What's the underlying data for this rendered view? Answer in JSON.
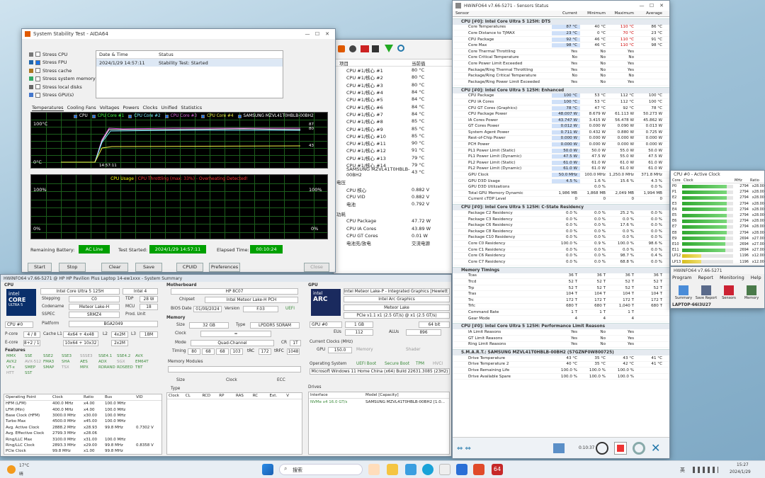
{
  "stability": {
    "title": "System Stability Test - AIDA64",
    "stress_items": [
      "Stress CPU",
      "Stress FPU",
      "Stress cache",
      "Stress system memory",
      "Stress local disks",
      "Stress GPU(s)"
    ],
    "log_headers": [
      "Date & Time",
      "Status"
    ],
    "log_row": [
      "2024/1/29 14:57:11",
      "Stability Test: Started"
    ],
    "tabs": [
      "Temperatures",
      "Cooling Fans",
      "Voltages",
      "Powers",
      "Clocks",
      "Unified",
      "Statistics"
    ],
    "legend": [
      "CPU",
      "CPU Core #1",
      "CPU Core #2",
      "CPU Core #3",
      "CPU Core #4",
      "SAMSUNG MZVL41T0HBLB-00BH2"
    ],
    "temp_top": "100°C",
    "temp_bot": "0°C",
    "temp_time": "14:57:11",
    "temp_r1": "87",
    "temp_r2": "80",
    "temp_r3": "43",
    "usage_title": "CPU Usage",
    "usage_throttle": "CPU Throttling (max: 33%) - Overheating Detected!",
    "usage_top_l": "100%",
    "usage_bot_l": "0%",
    "usage_top_r": "100%",
    "usage_bot_r": "0%",
    "battery_label": "Remaining Battery:",
    "battery_val": "AC Line",
    "started_label": "Test Started:",
    "started_val": "2024/1/29 14:57:11",
    "elapsed_label": "Elapsed Time:",
    "elapsed_val": "00:10:24",
    "buttons": [
      "Start",
      "Stop",
      "Clear",
      "Save",
      "CPUID",
      "Preferences",
      "Close"
    ]
  },
  "coretemps": {
    "col1": "项目",
    "col2": "当前值",
    "rows": [
      [
        "CPU #1/核心 #1",
        "80 °C"
      ],
      [
        "CPU #1/核心 #2",
        "80 °C"
      ],
      [
        "CPU #1/核心 #3",
        "80 °C"
      ],
      [
        "CPU #1/核心 #4",
        "84 °C"
      ],
      [
        "CPU #1/核心 #5",
        "84 °C"
      ],
      [
        "CPU #1/核心 #6",
        "84 °C"
      ],
      [
        "CPU #1/核心 #7",
        "84 °C"
      ],
      [
        "CPU #1/核心 #8",
        "85 °C"
      ],
      [
        "CPU #1/核心 #9",
        "85 °C"
      ],
      [
        "CPU #1/核心 #10",
        "85 °C"
      ],
      [
        "CPU #1/核心 #11",
        "90 °C"
      ],
      [
        "CPU #1/核心 #12",
        "91 °C"
      ],
      [
        "CPU #1/核心 #13",
        "79 °C"
      ],
      [
        "CPU #1/核心 #14",
        "79 °C"
      ],
      [
        "SAMSUNG MZVL41T0HBLB-00BH2",
        "43 °C"
      ]
    ],
    "volt_head": "电压",
    "volt": [
      [
        "CPU 核心",
        "0.882 V"
      ],
      [
        "CPU VID",
        "0.882 V"
      ],
      [
        "电池",
        "0.792 V"
      ]
    ],
    "power_head": "功耗",
    "power": [
      [
        "CPU Package",
        "47.72 W"
      ],
      [
        "CPU IA Cores",
        "43.89 W"
      ],
      [
        "CPU GT Cores",
        "0.01 W"
      ],
      [
        "电池充/放电",
        "交流电源"
      ]
    ]
  },
  "hwinfo": {
    "title": "HWiNFO64 v7.66-5271 - Sensors Status",
    "cols": [
      "Sensor",
      "Current",
      "Minimum",
      "Maximum",
      "Average"
    ],
    "g1": "CPU [#0]: Intel Core Ultra 5 125H: DTS",
    "g1rows": [
      [
        "Core Temperatures",
        "87 °C",
        "40 °C",
        "110 °C",
        "86 °C"
      ],
      [
        "Core Distance to TjMAX",
        "23 °C",
        "0 °C",
        "70 °C",
        "23 °C"
      ],
      [
        "CPU Package",
        "92 °C",
        "46 °C",
        "110 °C",
        "91 °C"
      ],
      [
        "Core Max",
        "98 °C",
        "46 °C",
        "110 °C",
        "98 °C"
      ],
      [
        "Core Thermal Throttling",
        "Yes",
        "No",
        "Yes",
        ""
      ],
      [
        "Core Critical Temperature",
        "No",
        "No",
        "No",
        ""
      ],
      [
        "Core Power Limit Exceeded",
        "Yes",
        "No",
        "Yes",
        ""
      ],
      [
        "Package/Ring Thermal Throttling",
        "Yes",
        "No",
        "Yes",
        ""
      ],
      [
        "Package/Ring Critical Temperature",
        "No",
        "No",
        "No",
        ""
      ],
      [
        "Package/Ring Power Limit Exceeded",
        "Yes",
        "No",
        "Yes",
        ""
      ]
    ],
    "g2": "CPU [#0]: Intel Core Ultra 5 125H: Enhanced",
    "g2rows": [
      [
        "CPU Package",
        "100 °C",
        "53 °C",
        "112 °C",
        "100 °C"
      ],
      [
        "CPU IA Cores",
        "100 °C",
        "53 °C",
        "112 °C",
        "100 °C"
      ],
      [
        "CPU GT Cores (Graphics)",
        "78 °C",
        "47 °C",
        "92 °C",
        "78 °C"
      ],
      [
        "CPU Package Power",
        "48.007 W",
        "8.679 W",
        "61.113 W",
        "50.273 W"
      ],
      [
        "IA Cores Power",
        "43.747 W",
        "3.415 W",
        "56.478 W",
        "45.862 W"
      ],
      [
        "GT Cores Power",
        "0.012 W",
        "0.000 W",
        "0.090 W",
        "0.013 W"
      ],
      [
        "System Agent Power",
        "0.711 W",
        "0.432 W",
        "0.880 W",
        "0.725 W"
      ],
      [
        "Rest-of-Chip Power",
        "0.000 W",
        "0.000 W",
        "0.000 W",
        "0.000 W"
      ],
      [
        "PCH Power",
        "0.000 W",
        "0.000 W",
        "0.000 W",
        "0.000 W"
      ],
      [
        "PL1 Power Limit (Static)",
        "50.0 W",
        "50.0 W",
        "55.0 W",
        "50.0 W"
      ],
      [
        "PL1 Power Limit (Dynamic)",
        "47.5 W",
        "47.5 W",
        "55.0 W",
        "47.5 W"
      ],
      [
        "PL2 Power Limit (Static)",
        "61.0 W",
        "61.0 W",
        "61.0 W",
        "61.0 W"
      ],
      [
        "PL2 Power Limit (Dynamic)",
        "61.0 W",
        "61.0 W",
        "61.0 W",
        "61.0 W"
      ],
      [
        "GPU Clock",
        "50.0 MHz",
        "100.0 MHz",
        "1,250.0 MHz",
        "371.8 MHz"
      ],
      [
        "GPU D3D Usage",
        "4.5 %",
        "1.6 %",
        "15.6 %",
        "4.3 %"
      ],
      [
        "GPU D3D Utilizations",
        "",
        "0.0 %",
        "",
        "0.0 %"
      ],
      [
        "Total GPU Memory Dynamic",
        "1,986 MB",
        "1,868 MB",
        "2,049 MB",
        "1,994 MB"
      ],
      [
        "Current cTDP Level",
        "0",
        "0",
        "0",
        "0"
      ]
    ],
    "g3": "CPU [#0]: Intel Core Ultra 5 125H: C-State Residency",
    "g3rows": [
      [
        "Package C2 Residency",
        "0.0 %",
        "0.0 %",
        "25.2 %",
        "0.0 %"
      ],
      [
        "Package C3 Residency",
        "0.0 %",
        "0.0 %",
        "0.0 %",
        "0.0 %"
      ],
      [
        "Package C6 Residency",
        "0.0 %",
        "0.0 %",
        "17.6 %",
        "0.0 %"
      ],
      [
        "Package C8 Residency",
        "0.0 %",
        "0.0 %",
        "0.0 %",
        "0.0 %"
      ],
      [
        "Package C10 Residency",
        "0.0 %",
        "0.0 %",
        "0.0 %",
        "0.0 %"
      ],
      [
        "Core C0 Residency",
        "100.0 %",
        "0.9 %",
        "100.0 %",
        "98.6 %"
      ],
      [
        "Core C1 Residency",
        "0.0 %",
        "0.0 %",
        "0.0 %",
        "0.0 %"
      ],
      [
        "Core C6 Residency",
        "0.0 %",
        "0.0 %",
        "98.7 %",
        "0.4 %"
      ],
      [
        "Core C7 Residency",
        "0.0 %",
        "0.0 %",
        "68.8 %",
        "0.0 %"
      ]
    ],
    "g4": "Memory Timings",
    "g4rows": [
      [
        "Tcas",
        "36 T",
        "36 T",
        "36 T",
        "36 T"
      ],
      [
        "Trcd",
        "52 T",
        "52 T",
        "52 T",
        "52 T"
      ],
      [
        "Trp",
        "52 T",
        "52 T",
        "52 T",
        "52 T"
      ],
      [
        "Tras",
        "104 T",
        "104 T",
        "104 T",
        "104 T"
      ],
      [
        "Trc",
        "172 T",
        "172 T",
        "172 T",
        "172 T"
      ],
      [
        "Trfc",
        "680 T",
        "680 T",
        "1,040 T",
        "680 T"
      ],
      [
        "Command Rate",
        "1 T",
        "1 T",
        "1 T",
        ""
      ],
      [
        "Gear Mode",
        "4",
        "4",
        "4",
        ""
      ]
    ],
    "g5": "CPU [#0]: Intel Core Ultra 5 125H: Performance Limit Reasons",
    "g5rows": [
      [
        "IA Limit Reasons",
        "Yes",
        "No",
        "Yes",
        ""
      ],
      [
        "GT Limit Reasons",
        "Yes",
        "No",
        "Yes",
        ""
      ],
      [
        "Ring Limit Reasons",
        "Yes",
        "No",
        "Yes",
        ""
      ]
    ],
    "g6": "S.M.A.R.T.: SAMSUNG MZVL41T0HBLB-00BH2 (S7GZNF0W800725)",
    "g6rows": [
      [
        "Drive Temperature",
        "43 °C",
        "35 °C",
        "43 °C",
        "41 °C"
      ],
      [
        "Drive Temperature 2",
        "40 °C",
        "35 °C",
        "42 °C",
        "41 °C"
      ],
      [
        "Drive Remaining Life",
        "100.0 %",
        "100.0 %",
        "100.0 %",
        ""
      ],
      [
        "Drive Available Spare",
        "100.0 %",
        "100.0 %",
        "100.0 %",
        ""
      ]
    ],
    "timer": "0:10:37"
  },
  "activeclock": {
    "title": "CPU #0 - Active Clock",
    "cols": [
      "Core",
      "Clock",
      "MHz",
      "Ratio"
    ],
    "rows": [
      [
        "P0",
        "2794",
        "x28.00"
      ],
      [
        "P1",
        "2794",
        "x28.00"
      ],
      [
        "E2",
        "2794",
        "x28.00"
      ],
      [
        "E3",
        "2794",
        "x28.00"
      ],
      [
        "E4",
        "2794",
        "x28.00"
      ],
      [
        "E5",
        "2794",
        "x28.00"
      ],
      [
        "E6",
        "2794",
        "x28.00"
      ],
      [
        "E7",
        "2794",
        "x28.00"
      ],
      [
        "E8",
        "2794",
        "x28.00"
      ],
      [
        "E9",
        "2694",
        "x27.00"
      ],
      [
        "E10",
        "2694",
        "x27.00"
      ],
      [
        "E11",
        "2694",
        "x27.00"
      ],
      [
        "LP12",
        "1196",
        "x12.00"
      ],
      [
        "LP13",
        "1196",
        "x12.00"
      ]
    ],
    "fill": [
      0.88,
      0.88,
      0.88,
      0.88,
      0.88,
      0.88,
      0.88,
      0.88,
      0.88,
      0.85,
      0.85,
      0.85,
      0.38,
      0.38
    ]
  },
  "hwmini": {
    "title": "HWiNFO64 v7.66-5271",
    "menu": [
      "Program",
      "Report",
      "Monitoring",
      "Help"
    ],
    "tools": [
      "Summary",
      "Save Report",
      "Sensors",
      "Memory"
    ],
    "host": "LAPTOP-66I3U27"
  },
  "summary": {
    "title": "HWiNFO64 v7.66-5271 @ HP HP Pavilion Plus Laptop 14-ew1xxx - System Summary",
    "cpu_head": "CPU",
    "cpu_name": "Intel Core Ultra 5 125H",
    "cpu_node": "Intel 4",
    "stepping_l": "Stepping",
    "stepping": "C0",
    "tdp_l": "TDP",
    "tdp": "28 W",
    "codename_l": "Codename",
    "codename": "Meteor Lake-H",
    "mcu_l": "MCU",
    "mcu": "18",
    "sspec_l": "SSPEC",
    "sspec": "SRMZ4",
    "prod_l": "Prod. Unit",
    "prod": "",
    "platform_l": "Platform",
    "platform": "BGA2049",
    "cpu_sel": "CPU #0",
    "pcore_l": "P-core",
    "pcore": "4 / 8",
    "cachel1_l": "Cache L1",
    "cachel1": "4x64 + 4x48",
    "l2_l": "L2",
    "l2": "4x2M",
    "l3_l": "L3",
    "l3": "18M",
    "ecore_l": "E-core",
    "ecore": "8+2 / 10",
    "cachee": "10x64 + 10x32",
    "l2e": "2x2M",
    "features_l": "Features",
    "features": [
      "MMX",
      "SSE",
      "SSE2",
      "SSE3",
      "SSSE3",
      "SSE4.1",
      "SSE4.2",
      "AVX",
      "AVX2",
      "AVX-512",
      "FMA3",
      "SHA",
      "AES",
      "ADX",
      "SGX",
      "EM64T",
      "VT-x",
      "SMEP",
      "SMAP",
      "TSX",
      "MPX",
      "RDRAND",
      "RDSEED",
      "TBT",
      "HTT",
      "SST"
    ],
    "op_head": [
      "Operating Point",
      "Clock",
      "Ratio",
      "Bus",
      "VID"
    ],
    "op_rows": [
      [
        "HFM (LFM)",
        "400.0 MHz",
        "x4.00",
        "100.0 MHz",
        ""
      ],
      [
        "LFM (Min)",
        "400.0 MHz",
        "x4.00",
        "100.0 MHz",
        ""
      ],
      [
        "Base Clock (HFM)",
        "3000.0 MHz",
        "x30.00",
        "100.0 MHz",
        ""
      ],
      [
        "Turbo Max",
        "4500.0 MHz",
        "x45.00",
        "100.0 MHz",
        ""
      ],
      [
        "Avg. Active Clock",
        "2888.2 MHz",
        "x28.93",
        "99.8 MHz",
        "0.7302 V"
      ],
      [
        "Avg. Effective Clock",
        "2799.3 MHz",
        "x28.06",
        "",
        ""
      ],
      [
        "Ring/LLC Max",
        "3100.0 MHz",
        "x31.00",
        "100.0 MHz",
        ""
      ],
      [
        "Ring/LLC Clock",
        "2893.3 MHz",
        "x29.00",
        "99.8 MHz",
        "0.8358 V"
      ],
      [
        "PCIe Clock",
        "99.8 MHz",
        "x1.00",
        "99.8 MHz",
        ""
      ]
    ],
    "mb_head": "Motherboard",
    "mb": "HP 8C07",
    "chipset_l": "Chipset",
    "chipset": "Intel Meteor Lake-H PCH",
    "bios_l": "BIOS Date",
    "bios": "01/09/2024",
    "ver_l": "Version",
    "ver": "F.03",
    "uefi": "UEFI",
    "mem_head": "Memory",
    "size_l": "Size",
    "size": "32 GB",
    "type_l": "Type",
    "type": "LPDDR5 SDRAM",
    "clock_l": "Clock",
    "clock": "=",
    "mode_l": "Mode",
    "mode": "Quad-Channel",
    "cr_l": "CR",
    "cr": "1T",
    "timing_l": "Timing",
    "timings": [
      "80",
      "68",
      "68",
      "103",
      "tRC",
      "172",
      "tRFC",
      "1048"
    ],
    "modules_l": "Memory Modules",
    "msize_l": "Size",
    "mclock_l": "Clock",
    "ecc_l": "ECC",
    "mtype_l": "Type",
    "mcols": [
      "Clock",
      "CL",
      "RCD",
      "RP",
      "RAS",
      "RC",
      "Ext.",
      "V"
    ],
    "gpu_head": "GPU",
    "gpu_name": "Intel Meteor Lake-P - Integrated Graphics [Hewlett Pac",
    "gpu_sub": "Intel Arc Graphics",
    "gpu_code": "Meteor Lake",
    "gpu_pcie": "PCIe v1.1 x1 (2.5 GT/s) @ x1 (2.5 GT/s)",
    "gpu_sel": "GPU #0",
    "gpu_mem": "1 GB",
    "gpu_bus": "64 bit",
    "eus_l": "EUs",
    "eus": "112",
    "alus_l": "ALUs",
    "alus": "896",
    "clocks_l": "Current Clocks (MHz)",
    "gpu_l": "GPU",
    "gpu_clk": "150.0",
    "mem_l": "Memory",
    "shader_l": "Shader",
    "os_l": "Operating System",
    "uefi_boot": "UEFI Boot",
    "secure": "Secure Boot",
    "tpm": "TPM",
    "hvci": "HVCI",
    "os": "Microsoft Windows 11 Home China (x64) Build 22631.3085 (23H2)",
    "drives_l": "Drives",
    "iface_l": "Interface",
    "model_l": "Model [Capacity]",
    "drive_iface": "NVMe x4 16.0 GT/s",
    "drive_model": "SAMSUNG MZVL41T0HBLB-00BH2 [1.0..."
  },
  "taskbar": {
    "temp": "17°C",
    "weather": "晴",
    "search": "搜索",
    "ime": "英",
    "time": "15:27",
    "date": "2024/1/29"
  }
}
